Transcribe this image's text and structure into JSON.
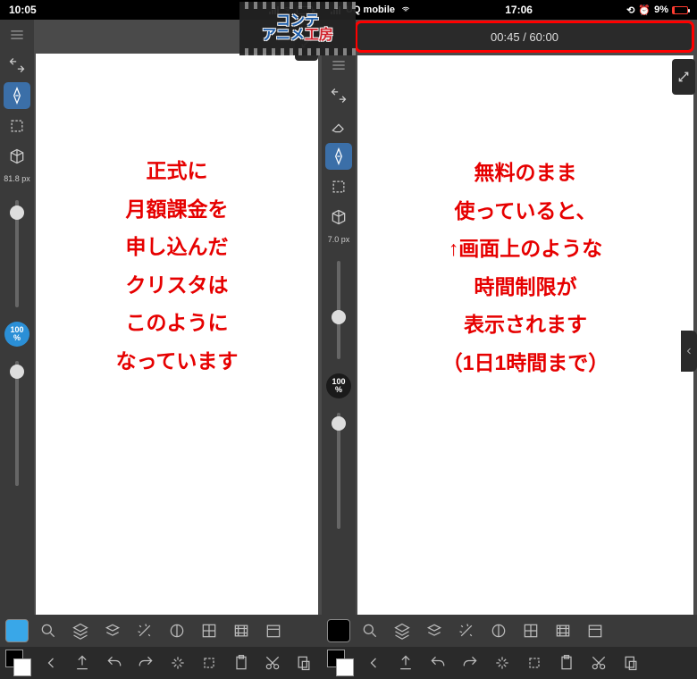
{
  "left": {
    "status": {
      "time": "10:05"
    },
    "brush_size": "81.8\npx",
    "zoom": "100\n%",
    "swatch_color": "#39a7e8",
    "canvas_text": "正式に\n月額課金を\n申し込んだ\nクリスタは\nこのように\nなっています"
  },
  "right": {
    "status": {
      "carrier": "UQ mobile",
      "time": "17:06",
      "battery": "9%"
    },
    "timer": "00:45 / 60:00",
    "brush_size": "7.0\npx",
    "zoom": "100\n%",
    "swatch_color": "#000000",
    "canvas_text": "無料のまま\n使っていると、\n↑画面上のような\n時間制限が\n表示されます\n（1日1時間まで）"
  },
  "logo": {
    "line1": "コンテ",
    "line2a": "アニメ",
    "line2b": "工房"
  },
  "icons": {
    "menu": "menu",
    "eyedropper": "eyedropper",
    "pen": "pen",
    "marquee": "marquee",
    "cube": "cube",
    "transform": "transform",
    "search": "search",
    "layers": "layers",
    "layers2": "layers",
    "wand": "wand",
    "adjust": "adjust",
    "grid": "grid",
    "film": "film",
    "calendar": "calendar",
    "chevl": "chev-left",
    "upload": "upload",
    "undo": "undo",
    "redo": "redo",
    "sparkle": "sparkle",
    "crop": "crop",
    "clipboard": "clipboard",
    "cut": "cut",
    "paste": "paste",
    "expand": "expand"
  }
}
